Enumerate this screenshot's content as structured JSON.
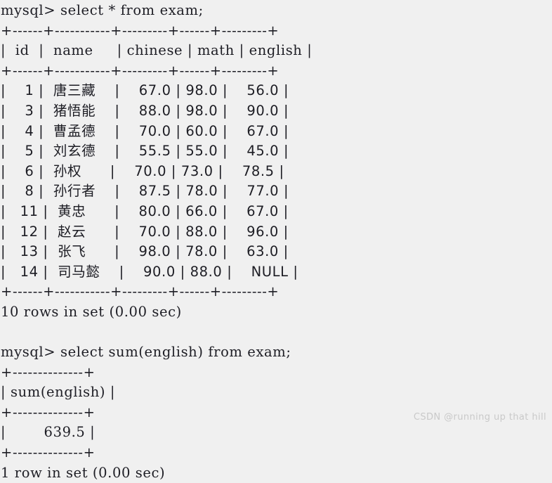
{
  "terminal": {
    "prompt": "mysql> ",
    "background_color": "#f0f0f0",
    "text_color": "#1d1d24",
    "watermark": "CSDN @running up that hill"
  },
  "query1": {
    "command": "mysql> select * from exam;",
    "separator": "+------+-----------+---------+------+---------+",
    "header_row": "|  id  |  name     | chinese | math | english |",
    "rows": [
      "|    1 |  唐三藏    |    67.0 | 98.0 |    56.0 |",
      "|    3 |  猪悟能    |    88.0 | 98.0 |    90.0 |",
      "|    4 |  曹孟德    |    70.0 | 60.0 |    67.0 |",
      "|    5 |  刘玄德    |    55.5 | 55.0 |    45.0 |",
      "|    6 |  孙权      |    70.0 | 73.0 |    78.5 |",
      "|    8 |  孙行者    |    87.5 | 78.0 |    77.0 |",
      "|   11 |  黄忠      |    80.0 | 66.0 |    67.0 |",
      "|   12 |  赵云      |    70.0 | 88.0 |    96.0 |",
      "|   13 |  张飞      |    98.0 | 78.0 |    63.0 |",
      "|   14 |  司马懿    |    90.0 | 88.0 |    NULL |"
    ],
    "result_line": "10 rows in set (0.00 sec)",
    "columns": [
      "id",
      "name",
      "chinese",
      "math",
      "english"
    ],
    "data": [
      {
        "id": "1",
        "name": "唐三藏",
        "chinese": "67.0",
        "math": "98.0",
        "english": "56.0"
      },
      {
        "id": "3",
        "name": "猪悟能",
        "chinese": "88.0",
        "math": "98.0",
        "english": "90.0"
      },
      {
        "id": "4",
        "name": "曹孟德",
        "chinese": "70.0",
        "math": "60.0",
        "english": "67.0"
      },
      {
        "id": "5",
        "name": "刘玄德",
        "chinese": "55.5",
        "math": "55.0",
        "english": "45.0"
      },
      {
        "id": "6",
        "name": "孙权",
        "chinese": "70.0",
        "math": "73.0",
        "english": "78.5"
      },
      {
        "id": "8",
        "name": "孙行者",
        "chinese": "87.5",
        "math": "78.0",
        "english": "77.0"
      },
      {
        "id": "11",
        "name": "黄忠",
        "chinese": "80.0",
        "math": "66.0",
        "english": "67.0"
      },
      {
        "id": "12",
        "name": "赵云",
        "chinese": "70.0",
        "math": "88.0",
        "english": "96.0"
      },
      {
        "id": "13",
        "name": "张飞",
        "chinese": "98.0",
        "math": "78.0",
        "english": "63.0"
      },
      {
        "id": "14",
        "name": "司马懿",
        "chinese": "90.0",
        "math": "88.0",
        "english": "NULL"
      }
    ]
  },
  "query2": {
    "blank": "",
    "command": "mysql> select sum(english) from exam;",
    "separator": "+--------------+",
    "header_row": "| sum(english) |",
    "value_row": "|        639.5 |",
    "result_line": "1 row in set (0.00 sec)",
    "columns": [
      "sum(english)"
    ],
    "data": [
      {
        "sum_english": "639.5"
      }
    ]
  }
}
